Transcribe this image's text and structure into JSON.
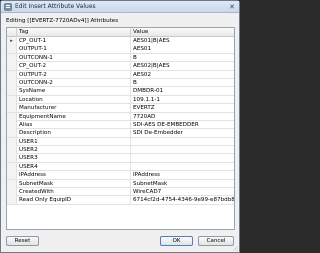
{
  "window": {
    "title": "Edit Insert Attribute Values"
  },
  "editing_label": "Editing [[EVERTZ-7720ADv4]] Attributes",
  "grid": {
    "columns": [
      "Tag",
      "Value"
    ],
    "active_row_index": 0,
    "rows": [
      {
        "tag": "CP_OUT-1",
        "value": "AES01|B|AES"
      },
      {
        "tag": "OUTPUT-1",
        "value": "AES01"
      },
      {
        "tag": "OUTCONN-1",
        "value": "B"
      },
      {
        "tag": "CP_OUT-2",
        "value": "AES02|B|AES"
      },
      {
        "tag": "OUTPUT-2",
        "value": "AES02"
      },
      {
        "tag": "OUTCONN-2",
        "value": "B"
      },
      {
        "tag": "SysName",
        "value": "DMBDR-01"
      },
      {
        "tag": "Location",
        "value": "109.1.1-1"
      },
      {
        "tag": "Manufacturer",
        "value": "EVERTZ"
      },
      {
        "tag": "EquipmentName",
        "value": "7720AD"
      },
      {
        "tag": "Alias",
        "value": "SDI-AES DE-EMBEDDER"
      },
      {
        "tag": "Description",
        "value": "SDI De-Embedder"
      },
      {
        "tag": "USER1",
        "value": ""
      },
      {
        "tag": "USER2",
        "value": ""
      },
      {
        "tag": "USER3",
        "value": ""
      },
      {
        "tag": "USER4",
        "value": ""
      },
      {
        "tag": "IPAddress",
        "value": "IPAddress"
      },
      {
        "tag": "SubnetMask",
        "value": "SubnetMask"
      },
      {
        "tag": "CreatedWith",
        "value": "WireCAD7"
      },
      {
        "tag": "Read Only EquipID",
        "value": "6714cf2d-4754-4346-9e99-e87bdb89cca6"
      }
    ]
  },
  "buttons": {
    "reset": "Reset",
    "ok": "OK",
    "cancel": "Cancel"
  },
  "selection_marker": "▸"
}
